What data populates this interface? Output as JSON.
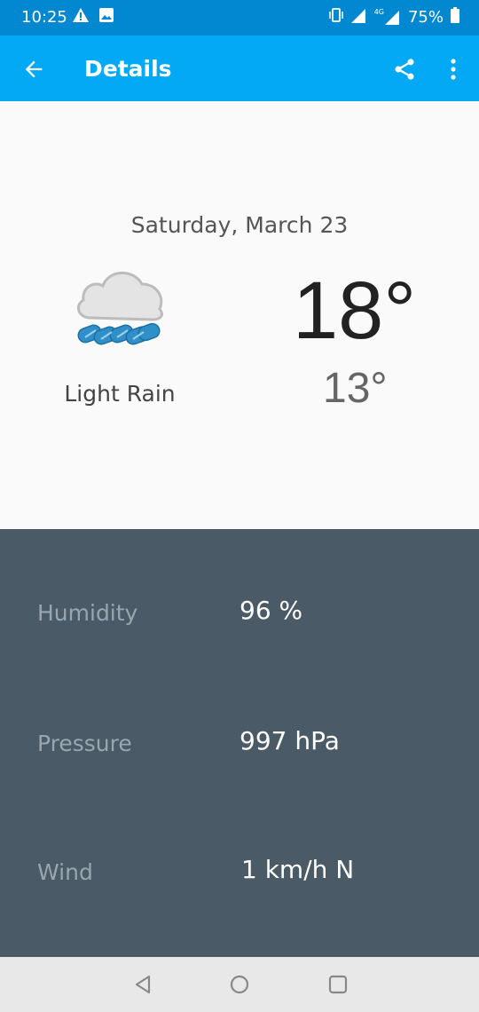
{
  "status_bar": {
    "time": "10:25",
    "battery": "75%",
    "network_label": "4G"
  },
  "app_bar": {
    "title": "Details",
    "icons": [
      "back-arrow-icon",
      "share-icon",
      "more-vert-icon"
    ]
  },
  "forecast": {
    "date": "Saturday, March 23",
    "condition": "Light Rain",
    "icon": "light-rain-icon",
    "high": "18°",
    "low": "13°"
  },
  "details": [
    {
      "label": "Humidity",
      "value": "96 %"
    },
    {
      "label": "Pressure",
      "value": "997 hPa"
    },
    {
      "label": "Wind",
      "value": "1 km/h N"
    }
  ],
  "colors": {
    "status_bar": "#0288d1",
    "app_bar": "#03a9f4",
    "details_bg": "#4a5a66",
    "rain_blue": "#2f8fc8"
  }
}
